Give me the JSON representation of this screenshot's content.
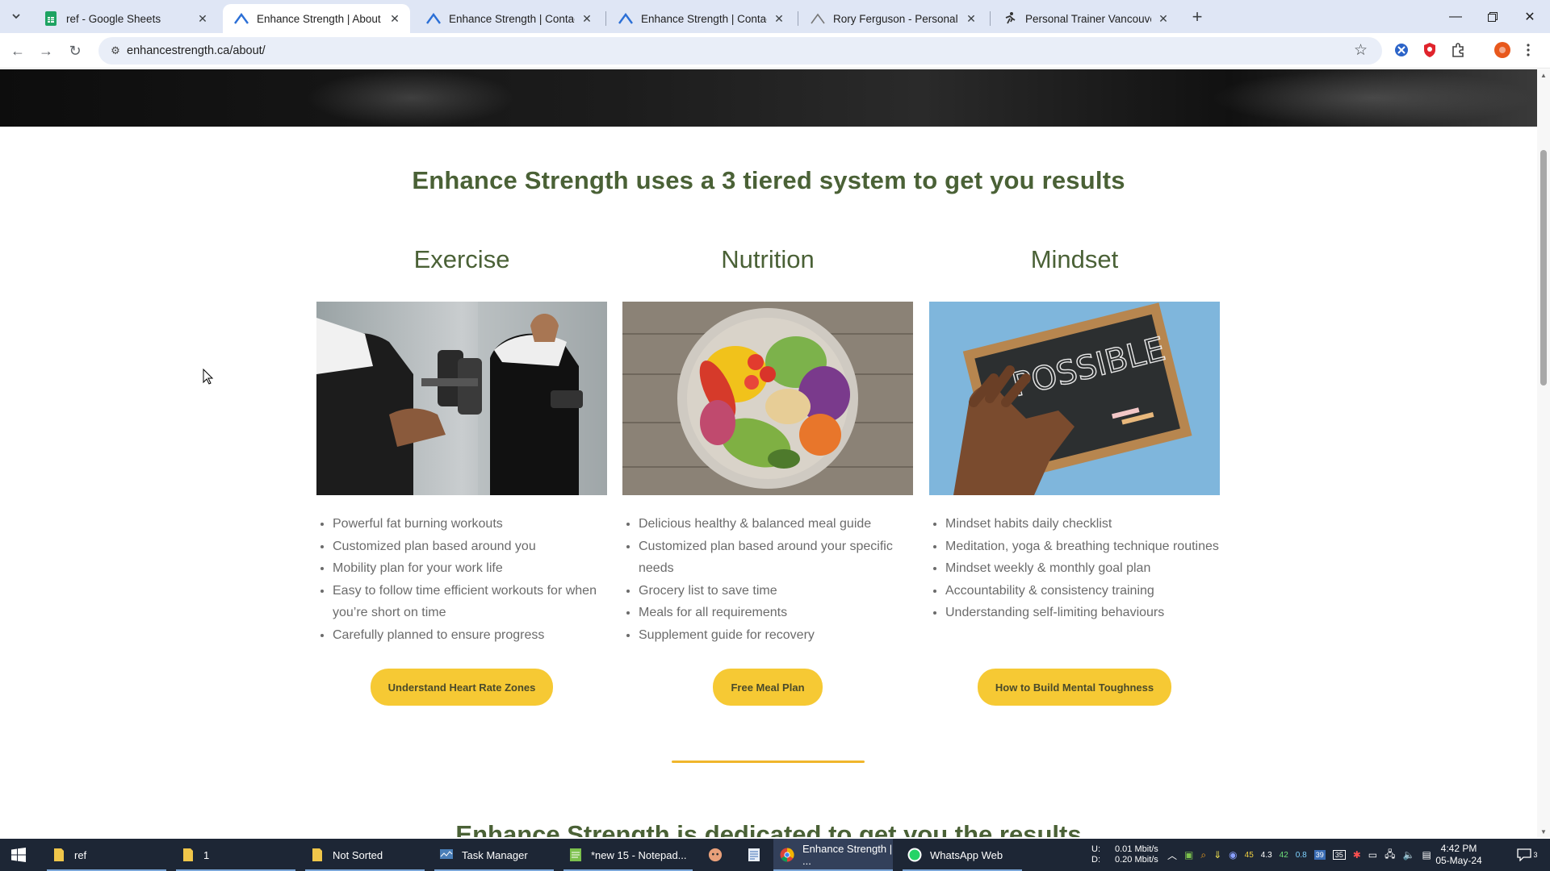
{
  "browser": {
    "tabs": [
      {
        "title": "ref - Google Sheets",
        "icon": "sheets-icon",
        "active": false
      },
      {
        "title": "Enhance Strength | About",
        "icon": "enhance-strength-icon",
        "active": true
      },
      {
        "title": "Enhance Strength | Contact",
        "icon": "enhance-strength-icon",
        "active": false
      },
      {
        "title": "Enhance Strength | Contact",
        "icon": "enhance-strength-icon",
        "active": false
      },
      {
        "title": "Rory Ferguson - Personal Traini",
        "icon": "rory-icon",
        "active": false
      },
      {
        "title": "Personal Trainer Vancouver | We",
        "icon": "trainer-icon",
        "active": false
      }
    ],
    "url": "enhancestrength.ca/about/"
  },
  "page": {
    "headline": "Enhance Strength uses a 3 tiered system to get you results",
    "columns": [
      {
        "title": "Exercise",
        "image": "dumbbell-workout-photo",
        "items": [
          "Powerful fat burning workouts",
          "Customized plan based around you",
          "Mobility plan for your work life",
          "Easy to follow time efficient workouts for when you’re short on time",
          "Carefully planned to ensure progress"
        ],
        "button": "Understand Heart Rate Zones"
      },
      {
        "title": "Nutrition",
        "image": "healthy-bowl-photo",
        "items": [
          "Delicious healthy & balanced meal guide",
          "Customized plan based around your specific needs",
          "Grocery list to save time",
          "Meals for all requirements",
          "Supplement guide for recovery"
        ],
        "button": "Free Meal Plan"
      },
      {
        "title": "Mindset",
        "image": "chalkboard-possible-photo",
        "items": [
          " Mindset habits daily checklist",
          " Meditation, yoga & breathing technique routines",
          "Mindset weekly & monthly goal plan",
          "Accountability & consistency training",
          "Understanding self-limiting behaviours"
        ],
        "button": "How to Build Mental Toughness"
      }
    ],
    "chalkboard_text": "POSSIBLE",
    "subheadline": "Enhance Strength is dedicated to get you the results"
  },
  "taskbar": {
    "items": [
      {
        "label": "ref",
        "icon": "folder-icon"
      },
      {
        "label": "1",
        "icon": "folder-icon"
      },
      {
        "label": "Not Sorted",
        "icon": "folder-icon"
      },
      {
        "label": "Task Manager",
        "icon": "task-manager-icon"
      },
      {
        "label": "*new 15 - Notepad...",
        "icon": "notepad-icon"
      },
      {
        "label": "",
        "icon": "app-icon"
      },
      {
        "label": "",
        "icon": "document-icon"
      },
      {
        "label": "Enhance Strength | ...",
        "icon": "chrome-icon"
      },
      {
        "label": "WhatsApp Web",
        "icon": "whatsapp-icon"
      }
    ],
    "net_up_label": "U:",
    "net_down_label": "D:",
    "net_up": "0.01 Mbit/s",
    "net_down": "0.20 Mbit/s",
    "tray_numbers": [
      "45",
      "4.3",
      "42",
      "0.8"
    ],
    "tray_badges": [
      "39",
      "35"
    ],
    "time": "4:42 PM",
    "date": "05-May-24",
    "notifications": "3"
  }
}
